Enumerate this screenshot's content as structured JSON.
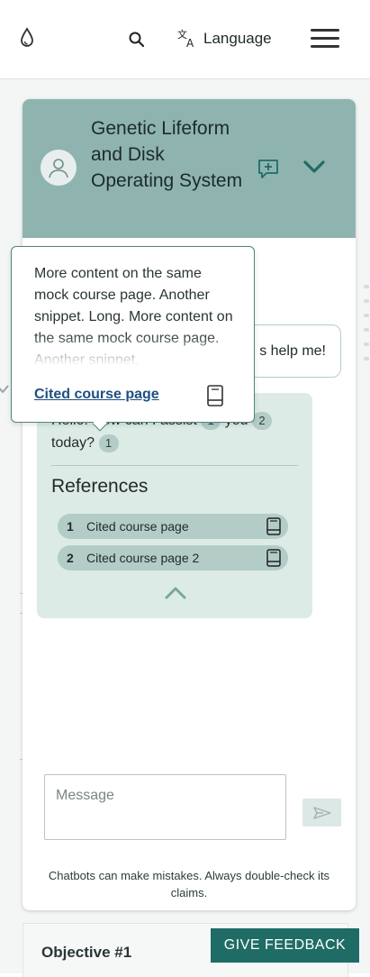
{
  "topbar": {
    "logo_icon": "water-drop-icon",
    "search_icon": "search-icon",
    "language_label": "Language",
    "language_icon": "translate-icon",
    "menu_icon": "hamburger-menu-icon"
  },
  "chat": {
    "title": "Genetic Lifeform and Disk Operating System",
    "avatar_icon": "user-avatar-icon",
    "new_chat_icon": "new-message-icon",
    "collapse_icon": "chevron-down-icon",
    "user_message": "s help me!",
    "bot_message": {
      "part1": "Hello! How can I assist",
      "cite1": "1",
      "part2": "you",
      "cite2": "2",
      "part3": "today?",
      "cite3": "1"
    },
    "references_title": "References",
    "references": [
      {
        "num": "1",
        "label": "Cited course page",
        "icon": "book-icon"
      },
      {
        "num": "2",
        "label": "Cited course page 2",
        "icon": "book-icon"
      }
    ],
    "references_collapse_icon": "chevron-up-icon",
    "message_placeholder": "Message",
    "send_icon": "send-icon",
    "disclaimer": "Chatbots can make mistakes. Always double-check its claims."
  },
  "tooltip": {
    "text": "More content on the same mock course page. Another snippet. Long. More content on the same mock course page. Another snippet.",
    "link_label": "Cited course page",
    "icon": "book-icon"
  },
  "objective": {
    "label": "Objective #1"
  },
  "feedback": {
    "label": "GIVE FEEDBACK"
  },
  "colors": {
    "header": "#8fb4b0",
    "bot_card": "#dcebe6",
    "pill": "#b3ccc8",
    "feedback": "#1f6c66",
    "link": "#1e4f82"
  }
}
